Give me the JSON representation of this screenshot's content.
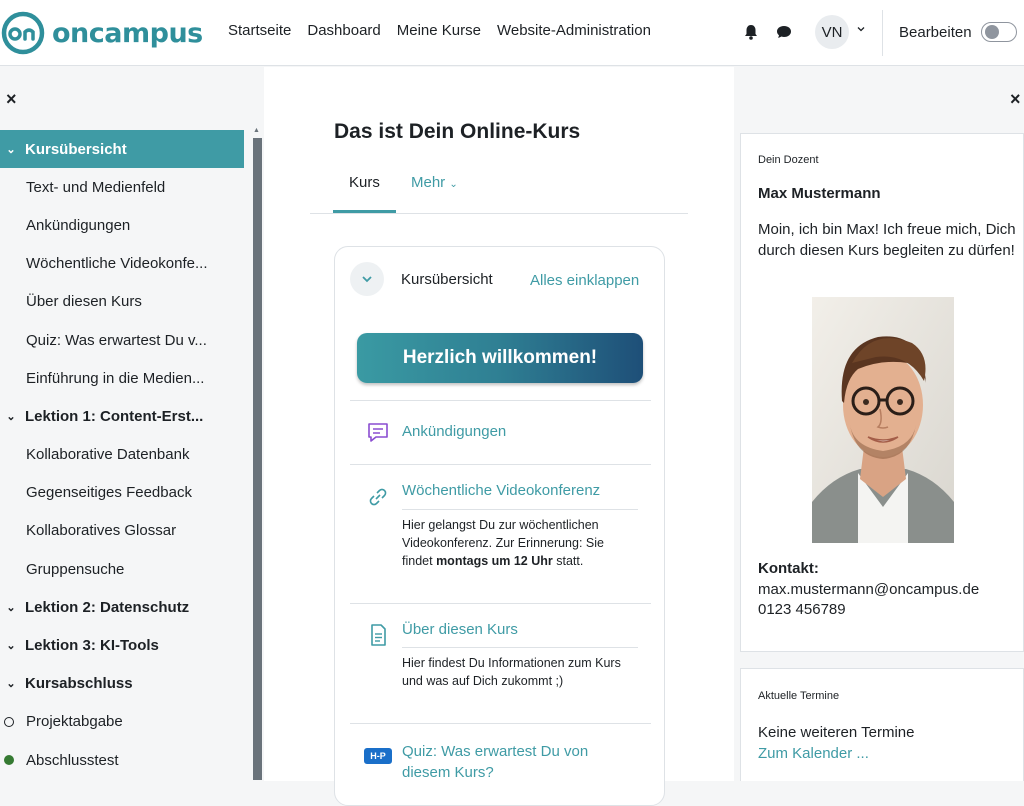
{
  "brand": {
    "name": "oncampus"
  },
  "nav": {
    "items": [
      "Startseite",
      "Dashboard",
      "Meine Kurse",
      "Website-Administration"
    ],
    "avatar_initials": "VN",
    "edit_label": "Bearbeiten"
  },
  "left_drawer": {
    "close": "×",
    "items": [
      {
        "label": "Kursübersicht",
        "type": "section",
        "active": true
      },
      {
        "label": "Text- und Medienfeld",
        "type": "item"
      },
      {
        "label": "Ankündigungen",
        "type": "item"
      },
      {
        "label": "Wöchentliche Videokonfe...",
        "type": "item"
      },
      {
        "label": "Über diesen Kurs",
        "type": "item"
      },
      {
        "label": "Quiz: Was erwartest Du v...",
        "type": "item"
      },
      {
        "label": "Einführung in die Medien...",
        "type": "item"
      },
      {
        "label": "Lektion 1: Content-Erst...",
        "type": "section"
      },
      {
        "label": "Kollaborative Datenbank",
        "type": "item"
      },
      {
        "label": "Gegenseitiges Feedback",
        "type": "item"
      },
      {
        "label": "Kollaboratives Glossar",
        "type": "item"
      },
      {
        "label": "Gruppensuche",
        "type": "item"
      },
      {
        "label": "Lektion 2: Datenschutz",
        "type": "section"
      },
      {
        "label": "Lektion 3: KI-Tools",
        "type": "section"
      },
      {
        "label": "Kursabschluss",
        "type": "section"
      },
      {
        "label": "Projektabgabe",
        "type": "completion-empty"
      },
      {
        "label": "Abschlusstest",
        "type": "completion-done"
      }
    ]
  },
  "main": {
    "title": "Das ist Dein Online-Kurs",
    "tabs": {
      "kurs": "Kurs",
      "mehr": "Mehr"
    },
    "card": {
      "section_title": "Kursübersicht",
      "collapse_all": "Alles einklappen",
      "welcome_banner": "Herzlich willkommen!",
      "activities": [
        {
          "title": "Ankündigungen",
          "icon": "forum-icon"
        },
        {
          "title": "Wöchentliche Videokonferenz",
          "icon": "url-link-icon",
          "desc_pre": "Hier gelangst Du zur wöchentlichen Videokonferenz. Zur Erinnerung: Sie findet ",
          "desc_bold": "montags um 12 Uhr",
          "desc_post": " statt."
        },
        {
          "title": "Über diesen Kurs",
          "icon": "page-icon",
          "desc": "Hier findest Du Informationen zum Kurs und was auf Dich zukommt ;)"
        },
        {
          "title": "Quiz: Was erwartest Du von diesem Kurs?",
          "icon": "h5p-icon",
          "icon_text": "H-P"
        }
      ]
    }
  },
  "right_drawer": {
    "close": "×",
    "teacher_block": {
      "heading": "Dein Dozent",
      "name": "Max Mustermann",
      "text": "Moin, ich bin Max! Ich freue mich, Dich durch diesen Kurs begleiten zu dürfen!",
      "contact_label": "Kontakt:",
      "email": "max.mustermann@oncampus.de",
      "phone": "0123 456789"
    },
    "events_block": {
      "heading": "Aktuelle Termine",
      "text": "Keine weiteren Termine",
      "link": "Zum Kalender ..."
    }
  },
  "colors": {
    "accent": "#3f9ba5",
    "brand": "#2f8f9b",
    "text": "#1d2125"
  }
}
